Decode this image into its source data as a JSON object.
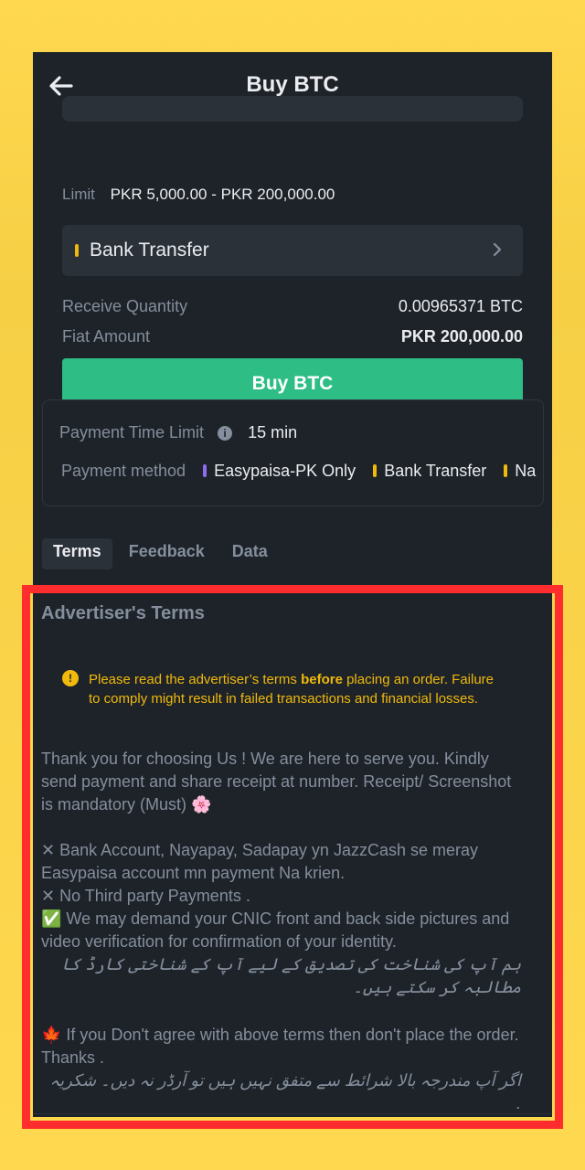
{
  "header": {
    "title": "Buy BTC"
  },
  "order": {
    "limit_label": "Limit",
    "limit_value": "PKR 5,000.00 - PKR 200,000.00",
    "payment_method_selected": "Bank Transfer",
    "receive_quantity_label": "Receive Quantity",
    "receive_quantity_value": "0.00965371 BTC",
    "fiat_amount_label": "Fiat Amount",
    "fiat_amount_value": "PKR 200,000.00",
    "buy_button_label": "Buy BTC"
  },
  "payment_info": {
    "time_limit_label": "Payment Time Limit",
    "time_limit_value": "15 min",
    "method_label": "Payment method",
    "methods": [
      {
        "label": "Easypaisa-PK Only",
        "color": "#8E6CEF"
      },
      {
        "label": "Bank Transfer",
        "color": "#F0B90B"
      },
      {
        "label": "Na",
        "color": "#F0B90B"
      }
    ]
  },
  "tabs": [
    {
      "label": "Terms",
      "active": true
    },
    {
      "label": "Feedback",
      "active": false
    },
    {
      "label": "Data",
      "active": false
    }
  ],
  "terms": {
    "title": "Advertiser's Terms",
    "warning_prefix": "Please read the advertiser’s terms ",
    "warning_bold": "before",
    "warning_suffix": " placing an order. Failure to comply might result in failed transactions and financial losses.",
    "paragraph1": "Thank you for choosing Us ! We are here to serve you. Kindly send payment and share receipt at number. Receipt/ Screenshot is mandatory (Must) 🌸",
    "line1": "✕ Bank Account, Nayapay, Sadapay yn JazzCash se meray Easypaisa account mn payment Na krien.",
    "line2": "✕ No Third party Payments .",
    "line3": "✅ We may demand your CNIC front and back side pictures and video verification for confirmation of your identity.",
    "urdu1": "ہم آپ کی شناخت کی تصدیق کے لیے آپ کے شناختی کارڈ کا مطالبہ کر سکتے ہیں۔",
    "line4": "🍁 If you Don't agree with above terms then don't place the order. Thanks .",
    "urdu2": "اگر آپ مندرجہ بالا شرائط سے متفق نہیں ہیں تو آرڈر نہ دیں۔ شکریہ ."
  },
  "colors": {
    "background_yellow": "#FFD84F",
    "app_dark": "#1E2329",
    "accent_green": "#2EBD85",
    "highlight_red": "#FF2D2D",
    "warning_yellow": "#F0B90B"
  }
}
